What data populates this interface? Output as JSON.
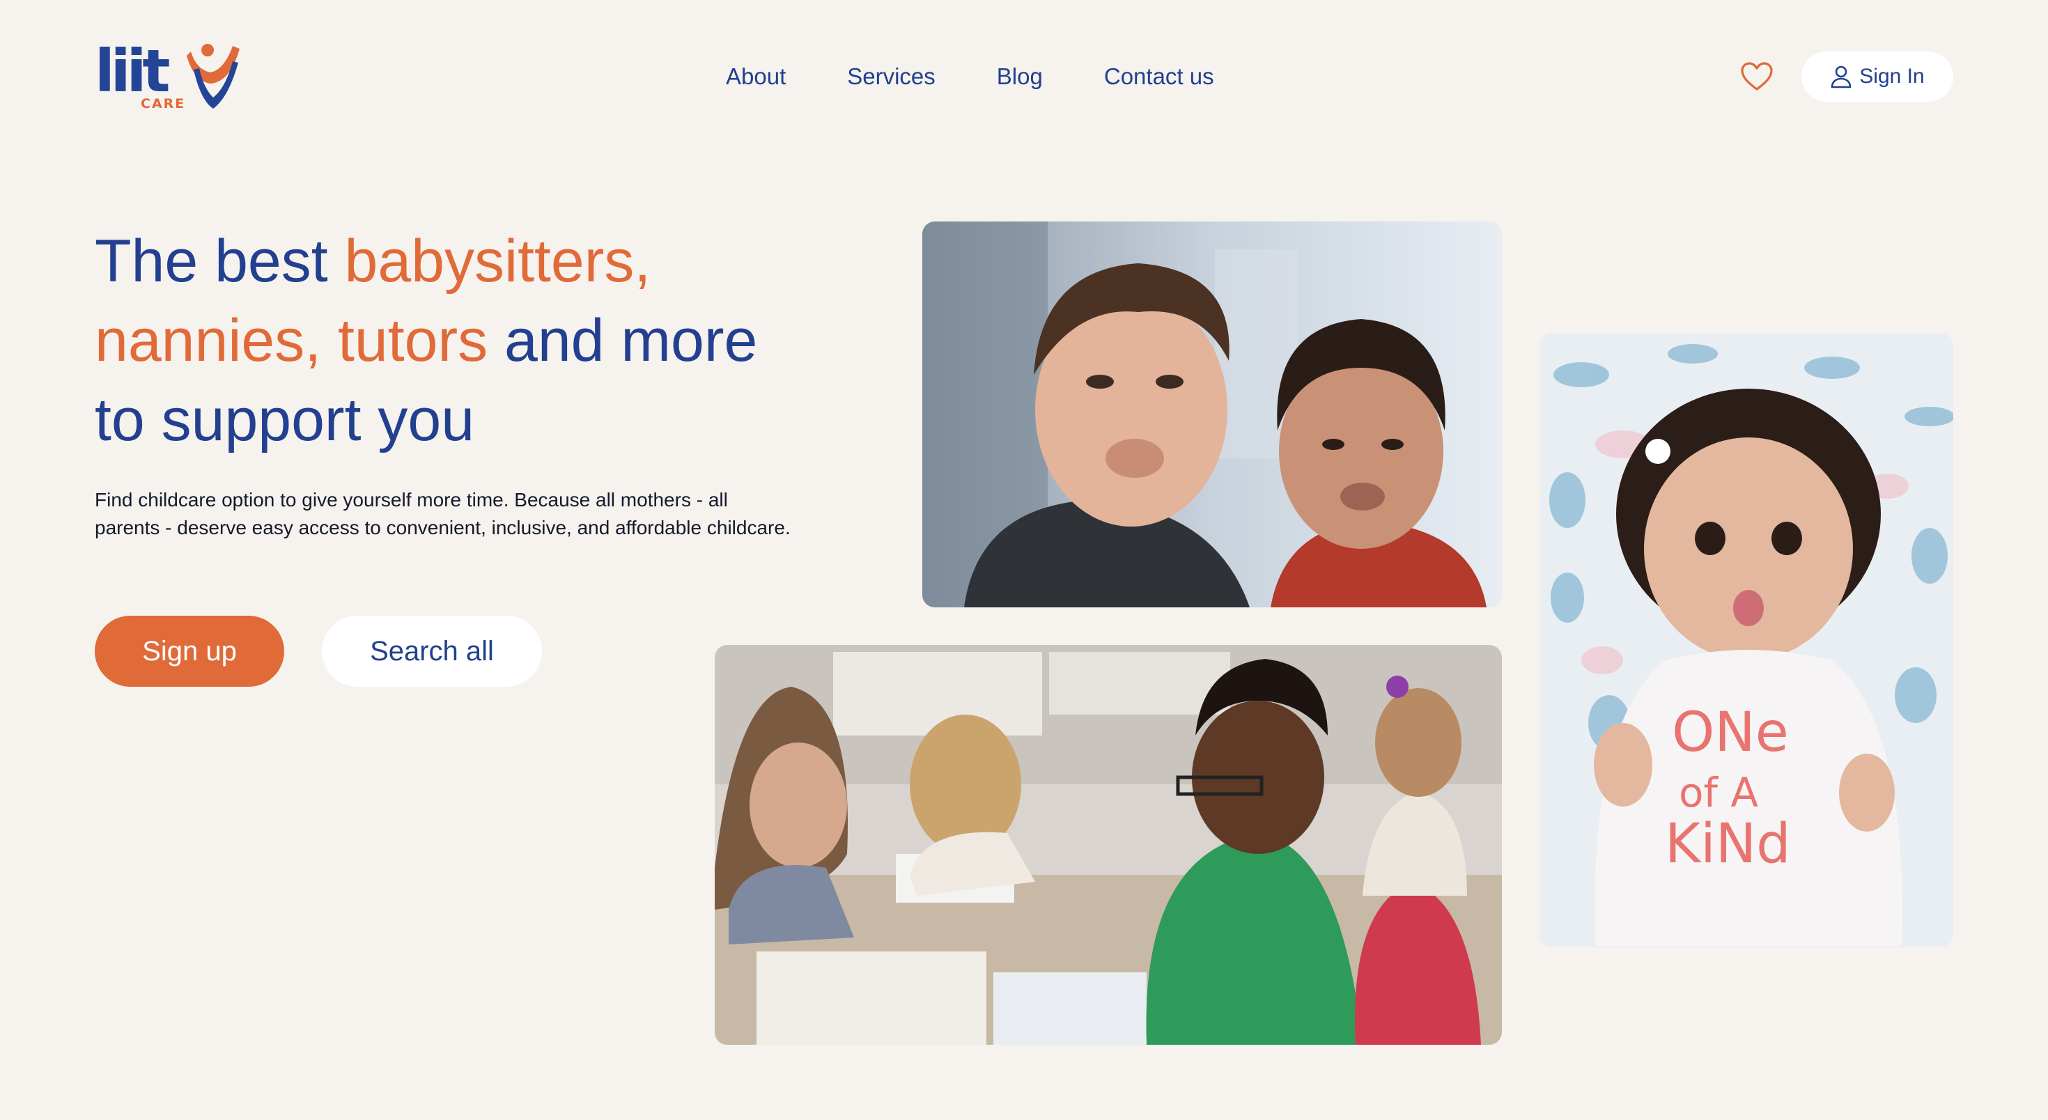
{
  "brand": {
    "logo_text": "liit",
    "logo_subtext": "CARE",
    "colors": {
      "primary": "#22408f",
      "accent": "#e06a38",
      "background": "#f6f2ee"
    }
  },
  "nav": {
    "items": [
      {
        "label": "About"
      },
      {
        "label": "Services"
      },
      {
        "label": "Blog"
      },
      {
        "label": "Contact us"
      }
    ]
  },
  "header": {
    "favorites_icon": "heart-icon",
    "signin_icon": "user-icon",
    "signin_label": "Sign In"
  },
  "hero": {
    "headline": {
      "part1": "The best ",
      "accent1": "babysitters,",
      "accent2": "nannies, tutors",
      "part2": " and more",
      "part3": "to support you"
    },
    "description": "Find childcare option to give yourself more time. Because all mothers - all parents - deserve easy access to convenient, inclusive, and affordable childcare.",
    "primary_button": "Sign up",
    "secondary_button": "Search all"
  },
  "photos": {
    "boys_shirt_text": "",
    "baby_shirt_line1": "ONe",
    "baby_shirt_line2": "of A",
    "baby_shirt_line3": "KiNd"
  }
}
